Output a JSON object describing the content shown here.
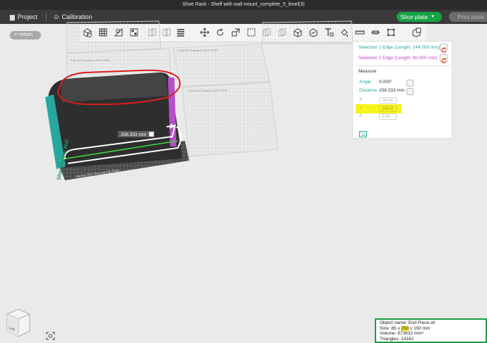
{
  "window": {
    "title": "Shoe Rack - Shelf with wall mount_complete_5_level(3)"
  },
  "menu": {
    "project_label": "Project",
    "calibration_label": "Calibration"
  },
  "actions": {
    "slice_label": "Slice plate",
    "print_label": "Print plate"
  },
  "canvas": {
    "return_label": "return",
    "plate_labels": [
      "Chat SCS Dynamic DTM TPRS",
      "Chat SCS Dynamic DTM TPRS",
      "Chat SCS Dynamic DTM TPRS",
      "Chat SCS Dynamic DTM TPRS",
      "Chat SCS Dynamic DTM TPRS"
    ],
    "active_plate_label": "Bambu Rite Textured PEI Plate",
    "side_text": "Shoe Rack & Wall",
    "distance_tag": "258.333 mm",
    "cube_face_label": "Left"
  },
  "measure": {
    "selection1": "Selection 1  Edge (Length: 144.000 mm)",
    "selection2": "Selection 2  Edge (Length: 90.000 mm)",
    "title": "Measure",
    "angle_label": "Angle",
    "angle_value": "0.000°",
    "distance_label": "Distance",
    "distance_value": "258.333 mm",
    "x_label": "X",
    "x_value": "-66.53",
    "y_label": "Y",
    "y_value": "249.62",
    "z_label": "Z",
    "z_value": "0.00"
  },
  "object_info": {
    "name": "Object name: End Piece.stl",
    "size_prefix": "Size: 85 x ",
    "size_highlight": "250",
    "size_suffix": " x 150 mm",
    "volume": "Volume: 873632 mm³",
    "triangles": "Triangles: 14162"
  },
  "colors": {
    "accent_green": "#17a346",
    "teal": "#26a6a0",
    "magenta": "#c53ad7",
    "annotation_red": "#d81e1e",
    "highlight_yellow": "#f7f41a"
  },
  "icons": [
    "add-object-icon",
    "grid-icon",
    "orient-icon",
    "arrange-icon",
    "split-object-icon",
    "split-parts-icon",
    "layers-icon",
    "move-icon",
    "rotate-icon",
    "scale-icon",
    "lay-on-face-icon",
    "cut-icon",
    "mesh-boolean-icon",
    "support-paint-icon",
    "seam-paint-icon",
    "text-icon",
    "color-paint-icon",
    "measure-icon",
    "assembly-icon",
    "emboss-icon",
    "view-cube",
    "zoom-fit-icon",
    "keyboard-icon"
  ]
}
